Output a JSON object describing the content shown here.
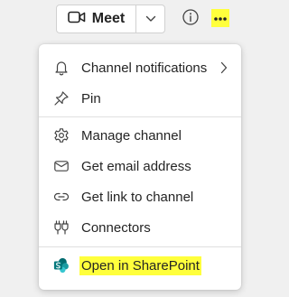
{
  "toolbar": {
    "meet_label": "Meet",
    "icons": {
      "meet": "video-camera-icon",
      "dropdown": "chevron-down-icon",
      "info": "info-icon",
      "more": "more-options-icon"
    },
    "highlight_color": "#ffff3c"
  },
  "menu": {
    "items": [
      {
        "label": "Channel notifications",
        "icon": "bell-icon",
        "submenu": true
      },
      {
        "label": "Pin",
        "icon": "pin-icon"
      },
      {
        "label": "Manage channel",
        "icon": "gear-icon"
      },
      {
        "label": "Get email address",
        "icon": "envelope-icon"
      },
      {
        "label": "Get link to channel",
        "icon": "link-icon"
      },
      {
        "label": "Connectors",
        "icon": "plug-icon"
      },
      {
        "label": "Open in SharePoint",
        "icon": "sharepoint-icon",
        "highlighted": true
      }
    ],
    "sharepoint_color": "#03787c"
  }
}
